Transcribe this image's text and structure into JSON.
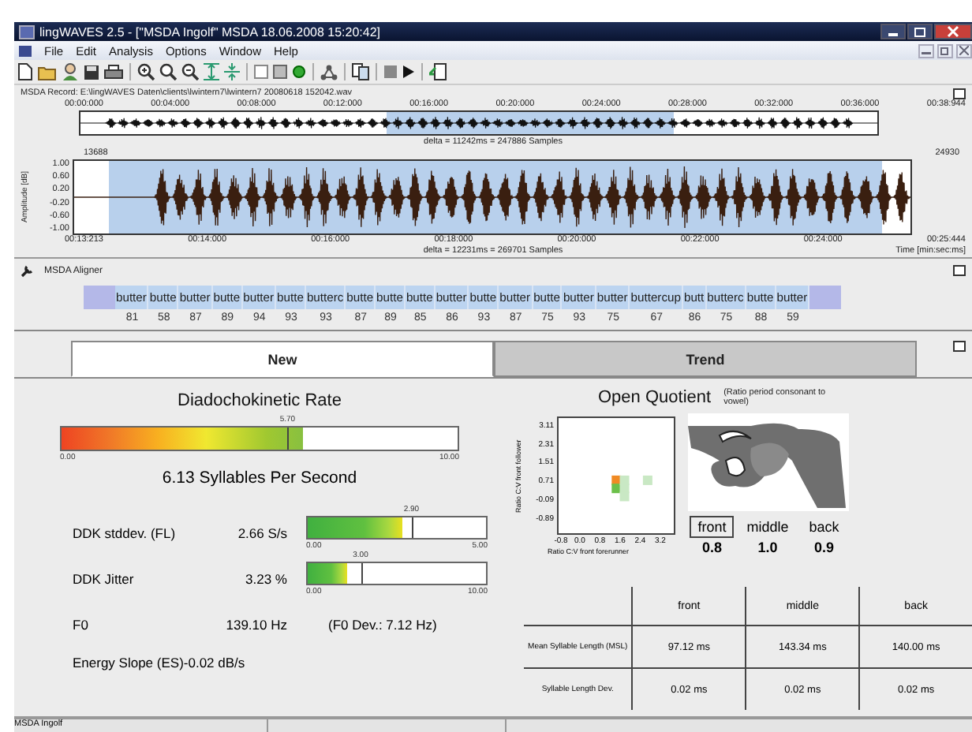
{
  "window": {
    "title": "lingWAVES 2.5 - [\"MSDA Ingolf\" MSDA  18.06.2008 15:20:42]"
  },
  "menu": [
    "File",
    "Edit",
    "Analysis",
    "Options",
    "Window",
    "Help"
  ],
  "record": {
    "path": "MSDA Record: E:\\lingWAVES  Daten\\clients\\lwintern7\\lwintern7  20080618  152042.wav",
    "overview_ticks": [
      "00:00:000",
      "00:04:000",
      "00:08:000",
      "00:12:000",
      "00:16:000",
      "00:20:000",
      "00:24:000",
      "00:28:000",
      "00:32:000",
      "00:36:000",
      "00:38:944"
    ],
    "overview_delta": "delta = 11242ms = 247886 Samples",
    "start_sample": "13688",
    "end_sample": "24930",
    "ylabel": "Amplitude [dB]",
    "yticks": [
      "1.00",
      "0.60",
      "0.20",
      "-0.20",
      "-0.60",
      "-1.00"
    ],
    "time_ticks": [
      "00:13:213",
      "00:14:000",
      "00:16:000",
      "00:18:000",
      "00:20:000",
      "00:22:000",
      "00:24:000",
      "00:25:444"
    ],
    "delta": "delta = 12231ms = 269701 Samples",
    "time_unit": "Time [min:sec:ms]"
  },
  "aligner": {
    "title": "MSDA Aligner",
    "segments": [
      {
        "label": "butter",
        "score": "81"
      },
      {
        "label": "butte",
        "score": "58"
      },
      {
        "label": "butter",
        "score": "87"
      },
      {
        "label": "butte",
        "score": "89"
      },
      {
        "label": "butter",
        "score": "94"
      },
      {
        "label": "butte",
        "score": "93"
      },
      {
        "label": "butterc",
        "score": "93"
      },
      {
        "label": "butte",
        "score": "87"
      },
      {
        "label": "butte",
        "score": "89"
      },
      {
        "label": "butte",
        "score": "85"
      },
      {
        "label": "butter",
        "score": "86"
      },
      {
        "label": "butte",
        "score": "93"
      },
      {
        "label": "butter",
        "score": "87"
      },
      {
        "label": "butte",
        "score": "75"
      },
      {
        "label": "butter",
        "score": "93"
      },
      {
        "label": "butter",
        "score": "75"
      },
      {
        "label": "buttercup",
        "score": "67"
      },
      {
        "label": "butt",
        "score": "86"
      },
      {
        "label": "butterc",
        "score": "75"
      },
      {
        "label": "butte",
        "score": "88"
      },
      {
        "label": "butter",
        "score": "59"
      }
    ]
  },
  "tabs": [
    {
      "label": "New",
      "selected": true
    },
    {
      "label": "Trend",
      "selected": false
    }
  ],
  "ddk": {
    "title": "Diadochokinetic Rate",
    "level": 0.61,
    "marker": "5.70",
    "min": "0.00",
    "max": "10.00",
    "result": "6.13 Syllables Per Second"
  },
  "measures": [
    {
      "kind": "bar",
      "label": "DDK stddev. (FL)",
      "value": "2.66 S/s",
      "level": 0.53,
      "marker": "2.90",
      "min": "0.00",
      "max": "5.00"
    },
    {
      "kind": "bar",
      "label": "DDK Jitter",
      "value": "3.23 %",
      "level": 0.22,
      "marker": "3.00",
      "min": "0.00",
      "max": "10.00"
    },
    {
      "kind": "text",
      "label": "F0",
      "value": "139.10 Hz",
      "note": "(F0 Dev.: 7.12 Hz)"
    }
  ],
  "energy_slope": "Energy Slope (ES)-0.02 dB/s",
  "open_quotient": {
    "title": "Open Quotient",
    "note": "(Ratio period consonant to vowel)",
    "chart_data": {
      "type": "scatter",
      "xlabel": "Ratio C:V front forerunner",
      "ylabel": "Ratio C:V front follower",
      "xlim": [
        -1.0,
        3.7
      ],
      "ylim": [
        -1.6,
        3.5
      ],
      "xticks": [
        {
          "value": -0.8,
          "label": "-0.8"
        },
        {
          "value": 0.0,
          "label": "0.0"
        },
        {
          "value": 0.8,
          "label": "0.8"
        },
        {
          "value": 1.6,
          "label": "1.6"
        },
        {
          "value": 2.4,
          "label": "2.4"
        },
        {
          "value": 3.2,
          "label": "3.2"
        }
      ],
      "yticks": [
        {
          "value": 3.11,
          "label": "3.11"
        },
        {
          "value": 2.31,
          "label": "2.31"
        },
        {
          "value": 1.51,
          "label": "1.51"
        },
        {
          "value": 0.71,
          "label": "0.71"
        },
        {
          "value": -0.09,
          "label": "-0.09"
        },
        {
          "value": -0.89,
          "label": "-0.89"
        }
      ],
      "x": [
        1.36,
        1.36,
        1.68,
        1.68,
        1.68,
        2.6
      ],
      "series": [
        {
          "color": "#f08a24",
          "values": [
            0.75,
            null,
            null,
            null,
            null,
            null
          ]
        },
        {
          "color": "#6cc04a",
          "values": [
            null,
            0.4,
            null,
            null,
            null,
            null
          ]
        },
        {
          "color": "#c9e8c4",
          "values": [
            null,
            null,
            0.75,
            0.4,
            0.05,
            0.75
          ]
        }
      ]
    },
    "positions": [
      {
        "label": "front",
        "value": "0.8",
        "selected": true
      },
      {
        "label": "middle",
        "value": "1.0",
        "selected": false
      },
      {
        "label": "back",
        "value": "0.9",
        "selected": false
      }
    ]
  },
  "table": {
    "columns": [
      "front",
      "middle",
      "back"
    ],
    "rows": [
      {
        "label": "Mean Syllable Length (MSL)",
        "cells": [
          "97.12 ms",
          "143.34 ms",
          "140.00 ms"
        ]
      },
      {
        "label": "Syllable Length Dev.",
        "cells": [
          "0.02 ms",
          "0.02 ms",
          "0.02 ms"
        ]
      }
    ]
  },
  "status_bar": "MSDA Ingolf"
}
